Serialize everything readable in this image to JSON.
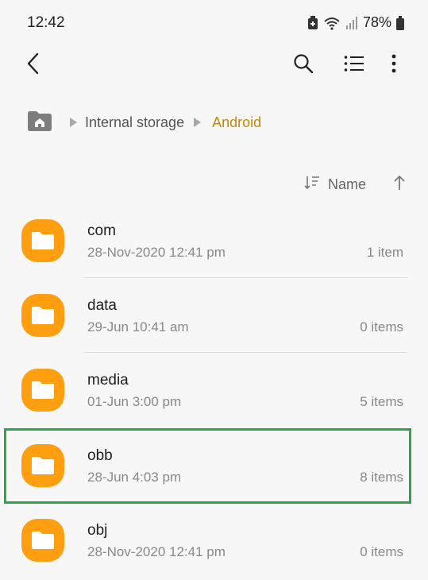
{
  "status": {
    "time": "12:42",
    "battery": "78%"
  },
  "toolbar": {
    "back_icon": "back-arrow-icon",
    "search_icon": "search-icon",
    "list_icon": "list-view-icon",
    "more_icon": "more-vert-icon"
  },
  "breadcrumb": {
    "home_icon": "home-folder-icon",
    "storage": "Internal storage",
    "current": "Android",
    "current_color": "#c98600"
  },
  "sort": {
    "label": "Name",
    "sort_icon": "sort-icon",
    "direction_icon": "arrow-up-icon"
  },
  "files": [
    {
      "name": "com",
      "date": "28-Nov-2020 12:41 pm",
      "count": "1 item"
    },
    {
      "name": "data",
      "date": "29-Jun 10:41 am",
      "count": "0 items"
    },
    {
      "name": "media",
      "date": "01-Jun 3:00 pm",
      "count": "5 items"
    },
    {
      "name": "obb",
      "date": "28-Jun 4:03 pm",
      "count": "8 items"
    },
    {
      "name": "obj",
      "date": "28-Nov-2020 12:41 pm",
      "count": "0 items"
    }
  ],
  "colors": {
    "folder": "#ff9f0f",
    "highlight": "#2ea44f"
  }
}
